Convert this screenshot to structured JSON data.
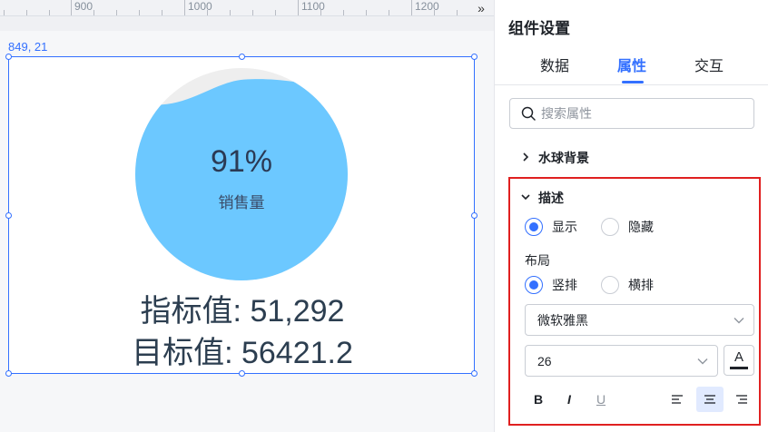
{
  "canvas": {
    "ruler": [
      "900",
      "1000",
      "1100",
      "1200"
    ],
    "collapse_label": "»",
    "coords": "849, 21"
  },
  "widget": {
    "percent": "91%",
    "label": "销售量",
    "fill_fraction": 0.91,
    "metric1": "指标值: 51,292",
    "metric2": "目标值: 56421.2",
    "colors": {
      "water": "#6cc8ff",
      "empty": "#eeeeee"
    }
  },
  "panel": {
    "title": "组件设置",
    "tabs": [
      "数据",
      "属性",
      "交互"
    ],
    "search_placeholder": "搜索属性",
    "section_bg": "水球背景",
    "section_desc": "描述",
    "show_label": "显示",
    "hide_label": "隐藏",
    "layout_label": "布局",
    "vertical_label": "竖排",
    "horizontal_label": "横排",
    "font_family": "微软雅黑",
    "font_size": "26",
    "color_label": "A",
    "bold": "B",
    "italic": "I",
    "underline": "U"
  },
  "colors": {
    "accent": "#3370ff",
    "highlight": "#e02020"
  }
}
